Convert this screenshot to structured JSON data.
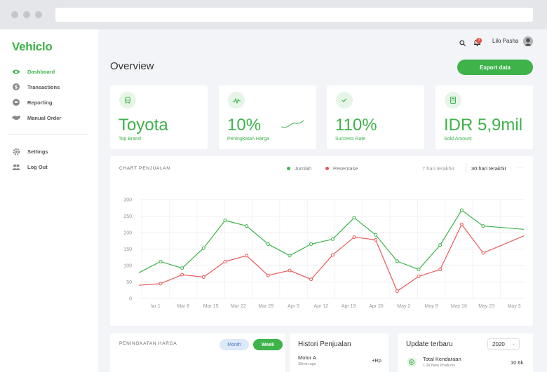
{
  "sidebar": {
    "logo": "Vehiclo",
    "items": [
      {
        "label": "Dashboard",
        "icon": "eye-icon"
      },
      {
        "label": "Transactions",
        "icon": "dollar-icon"
      },
      {
        "label": "Reporting",
        "icon": "report-icon"
      },
      {
        "label": "Manual Order",
        "icon": "handshake-icon"
      },
      {
        "label": "Settings",
        "icon": "gear-icon"
      },
      {
        "label": "Log Out",
        "icon": "users-icon"
      }
    ]
  },
  "topbar": {
    "username": "Lilo Pasha",
    "notification_count": "3"
  },
  "page": {
    "title": "Overview",
    "export_label": "Export data"
  },
  "stats": [
    {
      "value": "Toyota",
      "label": "Top Brand",
      "icon": "car-icon"
    },
    {
      "value": "10%",
      "label": "Peningkatan Harga",
      "icon": "trend-icon"
    },
    {
      "value": "110%",
      "label": "Success Rate",
      "icon": "check-icon"
    },
    {
      "value": "IDR 5,9mil",
      "label": "Sold Amount",
      "icon": "calculator-icon"
    }
  ],
  "chart_section": {
    "title": "CHART PENJUALAN",
    "legend_jumlah": "Jumlah",
    "legend_persentase": "Pesentase",
    "range_7": "7 hari terakhir",
    "range_30": "30 hari terakhir",
    "more": "···"
  },
  "chart_data": {
    "type": "line",
    "x": [
      "lar 1",
      "Mar 8",
      "Mar 15",
      "Mar 22",
      "Mar 29",
      "Apr 5",
      "Apr 12",
      "Apr 19",
      "Apr 26",
      "May 2",
      "May 9",
      "May 16",
      "May 23",
      "May 3"
    ],
    "ylim": [
      0,
      300
    ],
    "yticks": [
      0,
      50,
      100,
      150,
      200,
      250,
      300
    ],
    "grid": true,
    "series": [
      {
        "name": "Jumlah",
        "color": "#3db34a",
        "start": 78,
        "end": 210,
        "values": [
          112,
          92,
          153,
          237,
          220,
          165,
          130,
          165,
          180,
          245,
          193,
          113,
          88,
          162,
          268,
          220
        ]
      },
      {
        "name": "Pesentase",
        "color": "#e85a5a",
        "start": 40,
        "end": 190,
        "values": [
          45,
          72,
          65,
          112,
          130,
          70,
          85,
          58,
          132,
          186,
          178,
          22,
          67,
          88,
          225,
          138
        ]
      }
    ]
  },
  "bottom": {
    "price_title": "PENINGKATAN HARGA",
    "month_label": "Month",
    "week_label": "Week",
    "history_title": "Histori Penjualan",
    "history_item": "Motor A",
    "history_time": "30min ago",
    "history_value": "+Rp",
    "update_title": "Update terbaru",
    "year": "2020",
    "update_item": "Total Kendaraan",
    "update_sub": "1.2k New Products",
    "update_value": "10.6k"
  },
  "colors": {
    "accent": "#3db34a",
    "red": "#e85a5a"
  }
}
